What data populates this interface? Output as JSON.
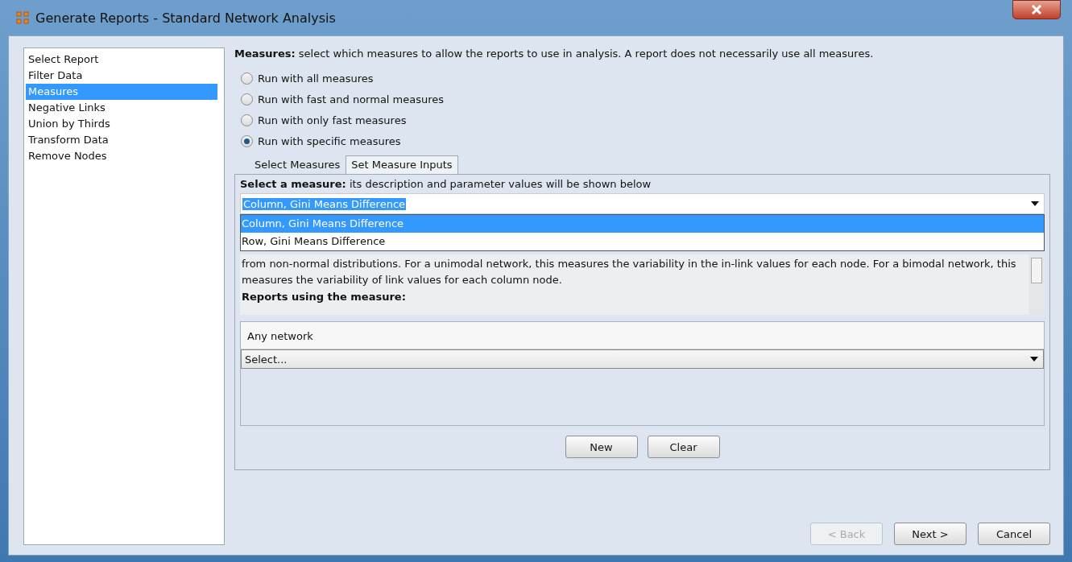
{
  "window": {
    "title": "Generate Reports - Standard Network Analysis"
  },
  "sidebar": {
    "items": [
      {
        "label": "Select Report",
        "selected": false
      },
      {
        "label": "Filter Data",
        "selected": false
      },
      {
        "label": "Measures",
        "selected": true
      },
      {
        "label": "Negative Links",
        "selected": false
      },
      {
        "label": "Union by Thirds",
        "selected": false
      },
      {
        "label": "Transform Data",
        "selected": false
      },
      {
        "label": "Remove Nodes",
        "selected": false
      }
    ]
  },
  "intro": "**Measures:** select which measures to allow the reports to use in analysis. A report does not necessarily use all measures.",
  "radios": [
    {
      "label": "Run with all measures",
      "selected": false
    },
    {
      "label": "Run with fast and normal measures",
      "selected": false
    },
    {
      "label": "Run with only fast measures",
      "selected": false
    },
    {
      "label": "Run with specific measures",
      "selected": true
    }
  ],
  "tabs": [
    {
      "label": "Select Measures",
      "selected": false
    },
    {
      "label": "Set Measure Inputs",
      "selected": true
    }
  ],
  "measure_select": {
    "hint": "**Select a measure:** its description and parameter values will be shown below",
    "value": "Column, Gini Means Difference",
    "options": [
      {
        "label": "Column, Gini Means Difference",
        "selected": true
      },
      {
        "label": "Row, Gini Means Difference",
        "selected": false
      }
    ]
  },
  "description": "from non-normal distributions. For a unimodal network, this measures the variability in the in-link values for each node. For a bimodal network, this measures the variability of link values for each column node.",
  "reports_heading": "Reports using the measure:",
  "reports": {
    "network_label": "Any network",
    "select_value": "Select..."
  },
  "panel_buttons": [
    "New",
    "Clear"
  ],
  "footer_buttons": [
    {
      "label": "< Back",
      "disabled": true
    },
    {
      "label": "Next >",
      "disabled": false
    },
    {
      "label": "Cancel",
      "disabled": false
    }
  ]
}
